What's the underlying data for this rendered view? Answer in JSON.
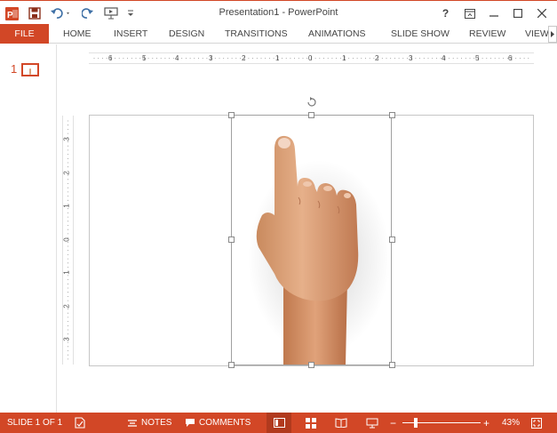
{
  "app": {
    "title": "Presentation1 - PowerPoint",
    "logo_text": "P",
    "help_label": "?",
    "brand_color": "#d24726"
  },
  "ribbon": {
    "file_label": "FILE",
    "tabs": [
      "HOME",
      "INSERT",
      "DESIGN",
      "TRANSITIONS",
      "ANIMATIONS",
      "SLIDE SHOW",
      "REVIEW",
      "VIEW"
    ]
  },
  "thumbnails": {
    "slide_number": "1"
  },
  "rulers": {
    "horizontal": [
      "6",
      "5",
      "4",
      "3",
      "2",
      "1",
      "0",
      "1",
      "2",
      "3",
      "4",
      "5",
      "6"
    ],
    "vertical": [
      "3",
      "2",
      "1",
      "0",
      "1",
      "2",
      "3"
    ]
  },
  "slide": {
    "image": "pointing-hand-image",
    "selected": true
  },
  "statusbar": {
    "slide_indicator": "SLIDE 1 OF 1",
    "notes_label": "NOTES",
    "comments_label": "COMMENTS",
    "zoom_minus": "−",
    "zoom_plus": "+",
    "zoom_level": "43%",
    "zoom_fraction": 0.43
  },
  "icons": [
    "powerpoint-logo-icon",
    "save-icon",
    "undo-icon",
    "redo-icon",
    "start-from-beginning-icon",
    "customize-qat-icon",
    "help-icon",
    "ribbon-display-options-icon",
    "minimize-icon",
    "maximize-icon",
    "close-icon",
    "spell-check-icon",
    "notes-icon",
    "comments-icon",
    "normal-view-icon",
    "slide-sorter-icon",
    "reading-view-icon",
    "slideshow-icon",
    "fit-slide-icon"
  ]
}
